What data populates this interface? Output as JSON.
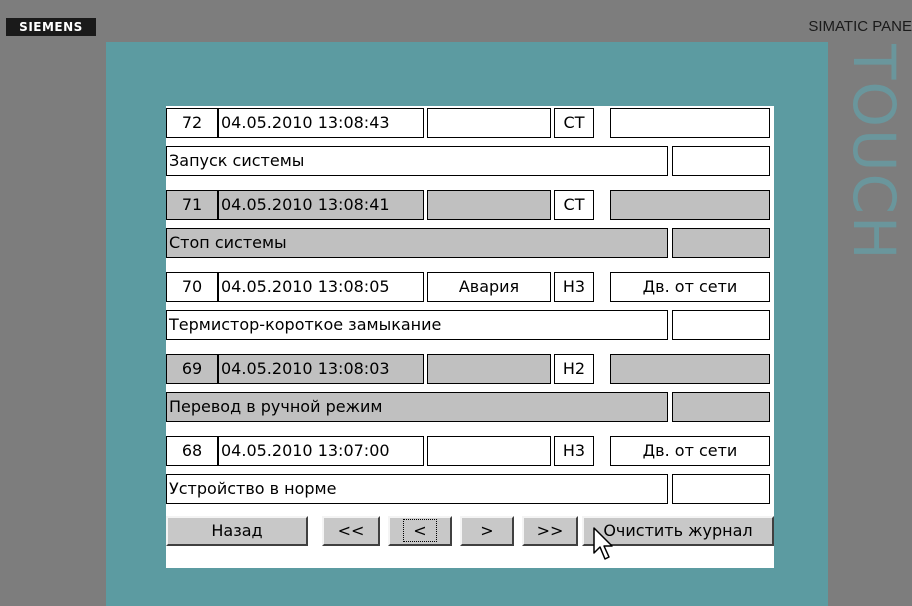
{
  "device": {
    "brand": "SIEMENS",
    "panel_name": "SIMATIC PANE",
    "touch_label": "TOUCH"
  },
  "log": [
    {
      "num": "72",
      "datetime": "04.05.2010 13:08:43",
      "type": "",
      "code": "CT",
      "source": "",
      "text": "Запуск системы",
      "extra": ""
    },
    {
      "num": "71",
      "datetime": "04.05.2010 13:08:41",
      "type": "",
      "code": "CT",
      "source": "",
      "text": "Стоп системы",
      "extra": ""
    },
    {
      "num": "70",
      "datetime": "04.05.2010 13:08:05",
      "type": "Авария",
      "code": "H3",
      "source": "Дв. от сети",
      "text": "Термистор-короткое замыкание",
      "extra": ""
    },
    {
      "num": "69",
      "datetime": "04.05.2010 13:08:03",
      "type": "",
      "code": "H2",
      "source": "",
      "text": "Перевод в ручной режим",
      "extra": ""
    },
    {
      "num": "68",
      "datetime": "04.05.2010 13:07:00",
      "type": "",
      "code": "H3",
      "source": "Дв. от сети",
      "text": "Устройство в норме",
      "extra": ""
    }
  ],
  "buttons": {
    "back": "Назад",
    "first": "<<",
    "prev": "<",
    "next": ">",
    "last": ">>",
    "clear": "Очистить журнал"
  },
  "colors": {
    "screen_bg": "#5c9ba1",
    "row_gray": "#c0c0c0",
    "bezel": "#7d7d7d"
  }
}
